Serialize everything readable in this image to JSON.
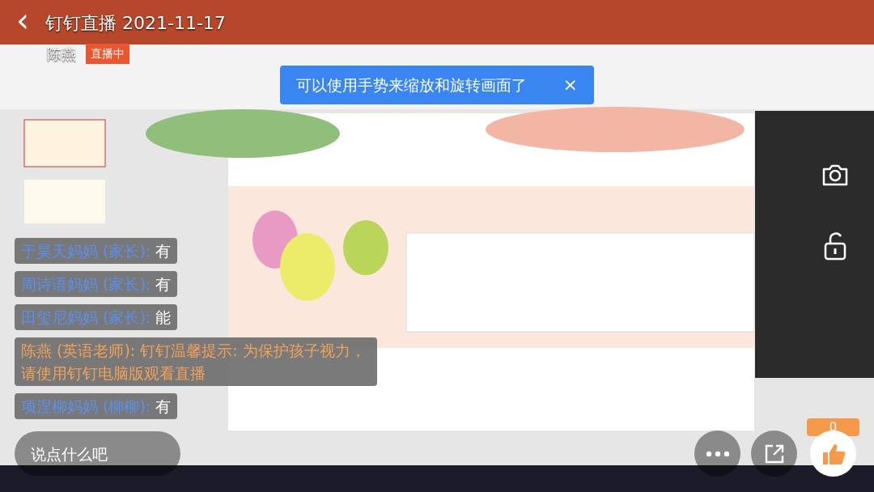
{
  "header": {
    "back": "‹",
    "title": "钉钉直播 2021-11-17"
  },
  "host": {
    "name": "陈燕",
    "badge": "直播中"
  },
  "toast": {
    "text": "可以使用手势来缩放和旋转画面了",
    "close": "×"
  },
  "comments": [
    {
      "kind": "parent",
      "name": "于昊天妈妈 (家长):",
      "text": "有"
    },
    {
      "kind": "parent",
      "name": "周诗语妈妈 (家长):",
      "text": "有"
    },
    {
      "kind": "parent",
      "name": "田玺尼妈妈 (家长):",
      "text": "能"
    },
    {
      "kind": "teacher",
      "name": "陈燕 (英语老师):",
      "text": "钉钉温馨提示: 为保护孩子视力，请使用钉钉电脑版观看直播"
    },
    {
      "kind": "parent",
      "name": "项涅柳妈妈 (柳柳):",
      "text": "有"
    }
  ],
  "input": {
    "placeholder": "说点什么吧"
  },
  "likes": "0"
}
